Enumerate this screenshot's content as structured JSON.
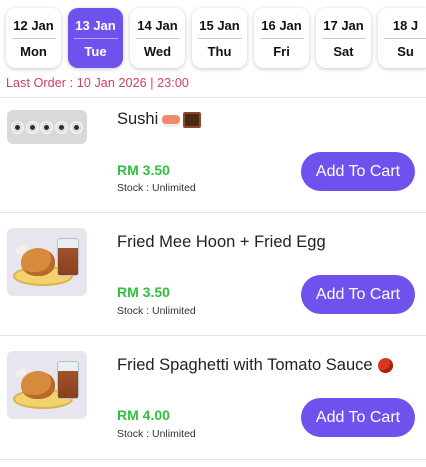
{
  "dates": [
    {
      "day": "12 Jan",
      "weekday": "Mon",
      "active": false
    },
    {
      "day": "13 Jan",
      "weekday": "Tue",
      "active": true
    },
    {
      "day": "14 Jan",
      "weekday": "Wed",
      "active": false
    },
    {
      "day": "15 Jan",
      "weekday": "Thu",
      "active": false
    },
    {
      "day": "16 Jan",
      "weekday": "Fri",
      "active": false
    },
    {
      "day": "17 Jan",
      "weekday": "Sat",
      "active": false
    },
    {
      "day": "18 J",
      "weekday": "Su",
      "active": false
    }
  ],
  "last_order": "Last Order : 10 Jan 2026 | 23:00",
  "colors": {
    "accent": "#6f52ee",
    "price": "#2fbf3f",
    "last_order": "#d23a6b"
  },
  "menu": [
    {
      "name": "Sushi",
      "name_icons": [
        "sushi-emoji",
        "bento-emoji"
      ],
      "price": "RM 3.50",
      "stock": "Stock : Unlimited",
      "button": "Add To Cart"
    },
    {
      "name": "Fried Mee Hoon + Fried Egg",
      "name_icons": [],
      "price": "RM 3.50",
      "stock": "Stock : Unlimited",
      "button": "Add To Cart"
    },
    {
      "name": "Fried Spaghetti with Tomato Sauce",
      "name_icons": [
        "tomato-emoji"
      ],
      "price": "RM 4.00",
      "stock": "Stock : Unlimited",
      "button": "Add To Cart"
    }
  ]
}
